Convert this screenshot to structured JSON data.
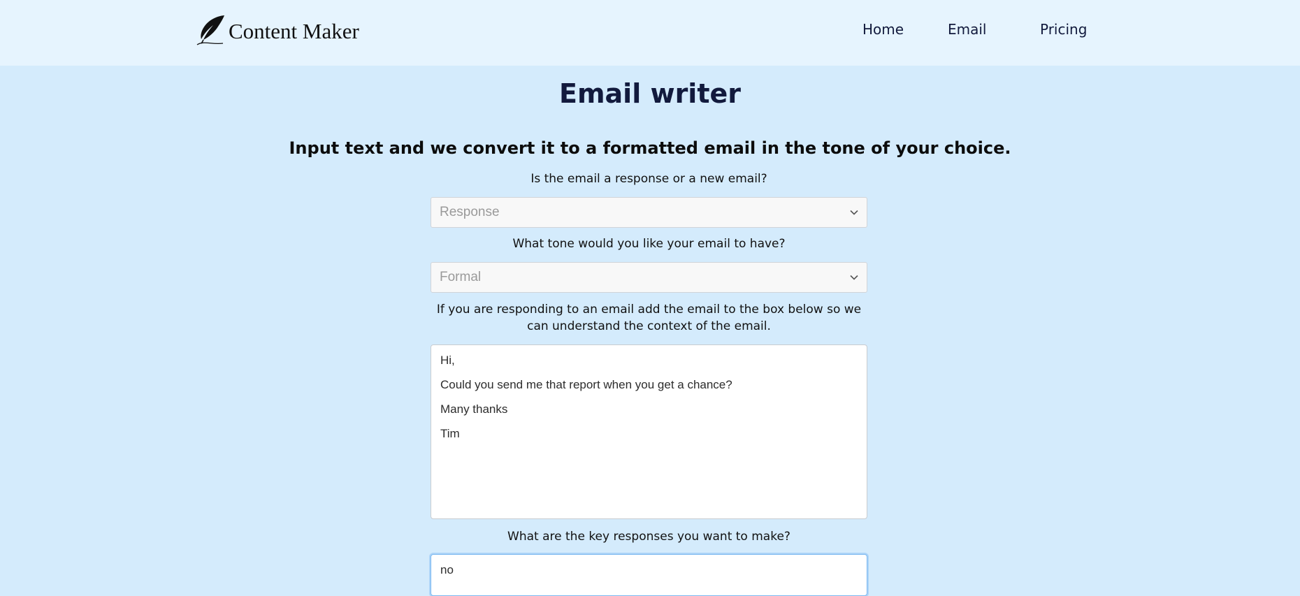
{
  "header": {
    "brand": "Content Maker",
    "nav": [
      {
        "label": "Home"
      },
      {
        "label": "Email"
      },
      {
        "label": "Pricing"
      }
    ]
  },
  "main": {
    "title": "Email writer",
    "subtitle": "Input text and we convert it to a formatted email in the tone of your choice.",
    "email_type": {
      "label": "Is the email a response or a new email?",
      "value": "Response"
    },
    "tone": {
      "label": "What tone would you like your email to have?",
      "value": "Formal"
    },
    "context": {
      "label": "If you are responding to an email add the email to the box below so we can understand the context of the email.",
      "lines": [
        "Hi,",
        "Could you send me that report when you get a chance?",
        "Many thanks",
        "Tim"
      ]
    },
    "key_responses": {
      "label": "What are the key responses you want to make?",
      "value": "no"
    }
  },
  "colors": {
    "background": "#d4ebfc",
    "header_background": "#e6f4fe",
    "text_dark": "#121a3d"
  },
  "icons": {
    "logo": "quill-feather-icon",
    "select_arrow": "chevron-down-icon"
  }
}
